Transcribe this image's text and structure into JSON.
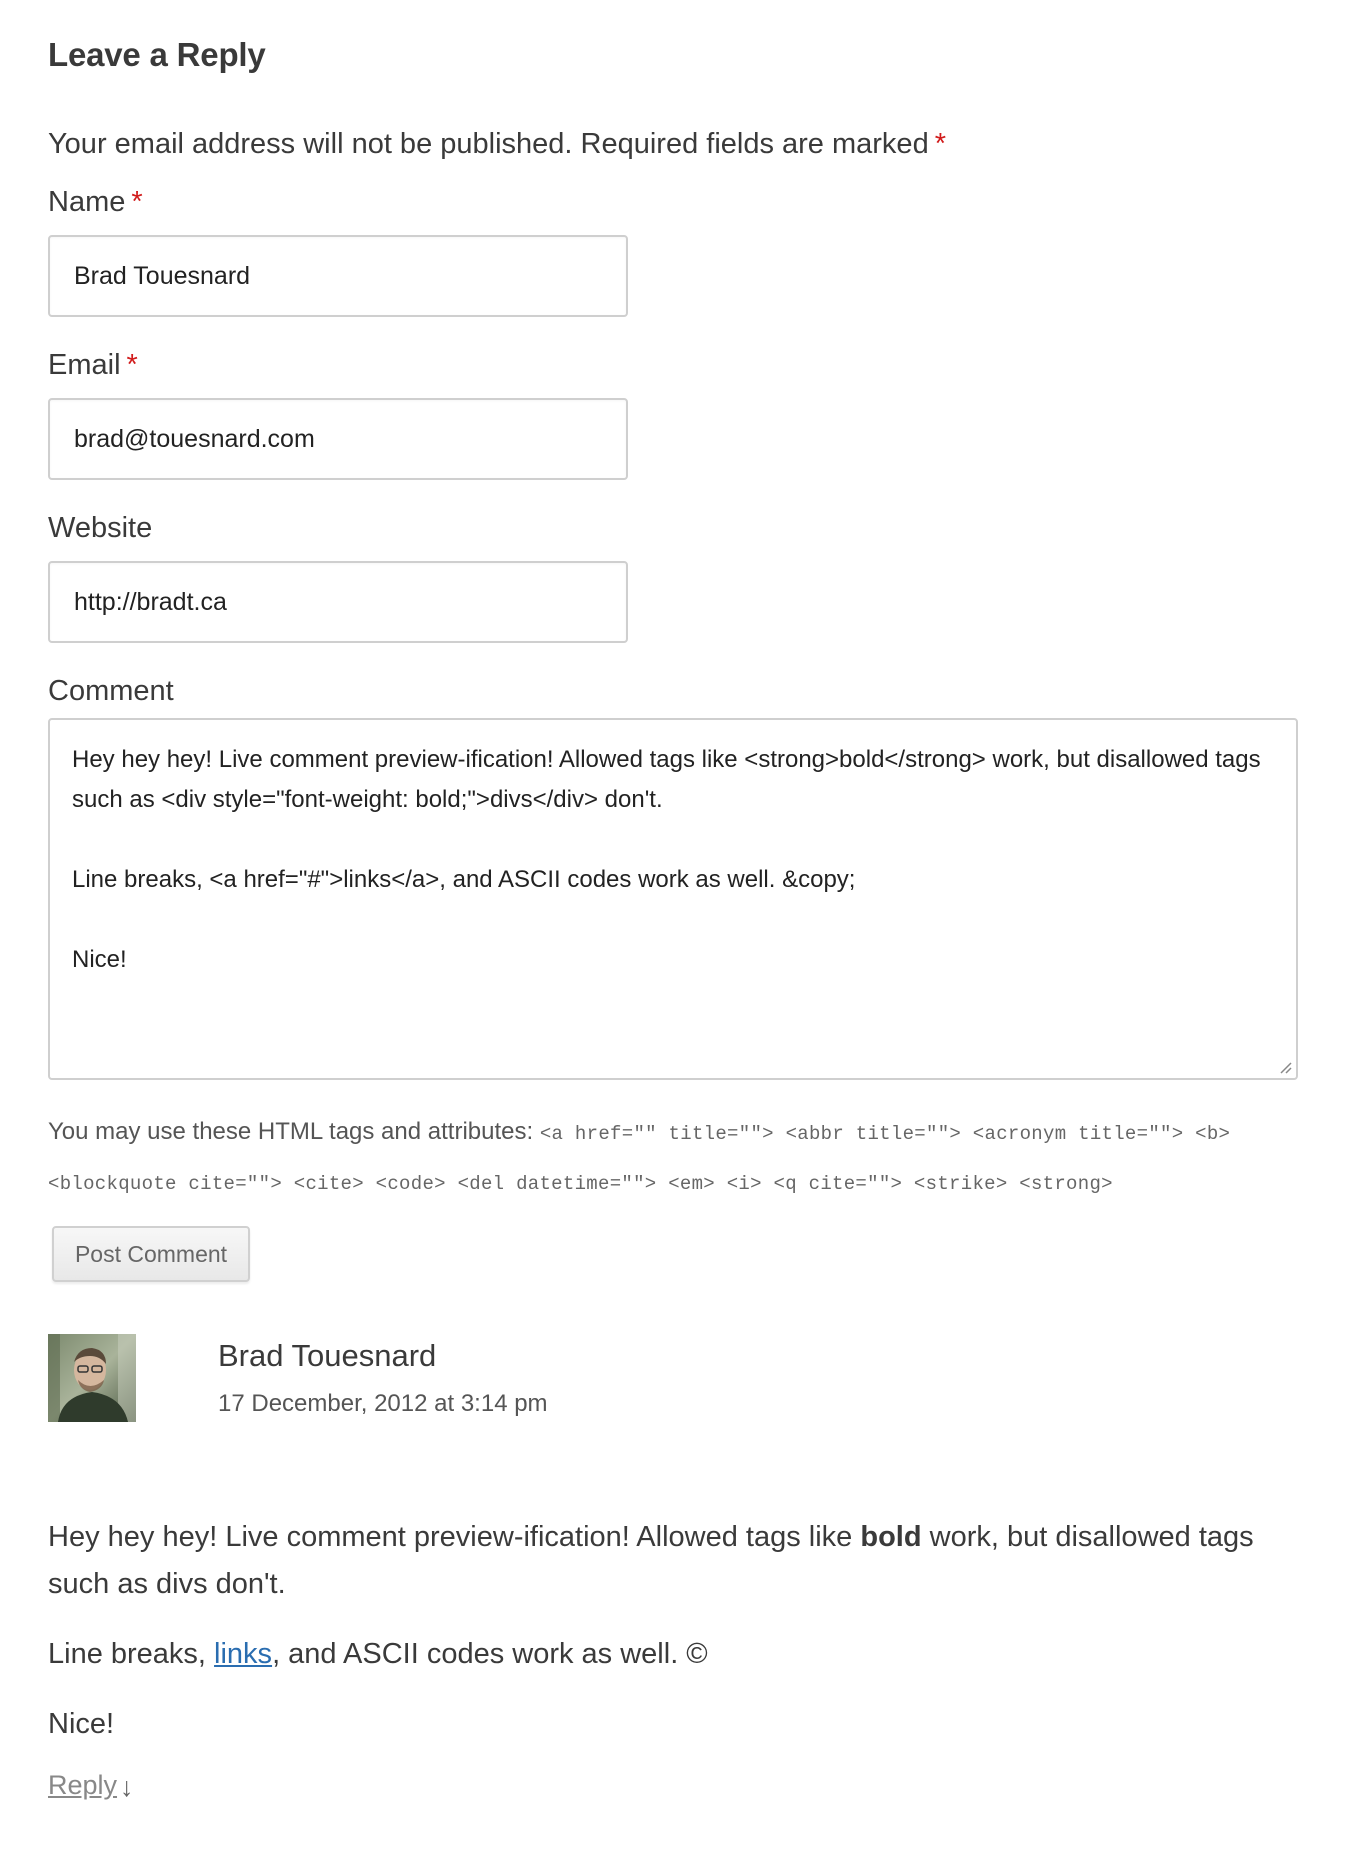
{
  "reply_form": {
    "title": "Leave a Reply",
    "notes": "Your email address will not be published. Required fields are marked",
    "required_mark": "*",
    "name_label": "Name",
    "name_value": "Brad Touesnard",
    "email_label": "Email",
    "email_value": "brad@touesnard.com",
    "website_label": "Website",
    "website_value": "http://bradt.ca",
    "comment_label": "Comment",
    "comment_value": "Hey hey hey! Live comment preview-ification! Allowed tags like <strong>bold</strong> work, but disallowed tags such as <div style=\"font-weight: bold;\">divs</div> don't.\n\nLine breaks, <a href=\"#\">links</a>, and ASCII codes work as well. &copy;\n\nNice!",
    "allowed_tags_intro": "You may use these HTML tags and attributes:",
    "allowed_tags": "<a href=\"\" title=\"\"> <abbr title=\"\"> <acronym title=\"\"> <b> <blockquote cite=\"\"> <cite> <code> <del datetime=\"\"> <em> <i> <q cite=\"\"> <strike> <strong>",
    "submit_label": "Post Comment"
  },
  "comment": {
    "author": "Brad Touesnard",
    "date": "17 December, 2012 at 3:14 pm",
    "avatar_icon": "user-avatar-photo",
    "paragraph1_before": "Hey hey hey! Live comment preview-ification! Allowed tags like ",
    "paragraph1_bold": "bold",
    "paragraph1_after": " work, but disallowed tags such as divs don't.",
    "paragraph2_before": "Line breaks, ",
    "paragraph2_link": "links",
    "paragraph2_after": ", and ASCII codes work as well. ©",
    "paragraph3": "Nice!",
    "reply_label": "Reply",
    "reply_arrow": "↓"
  },
  "colors": {
    "required": "#d11b1b",
    "link": "#2a6db0",
    "text": "#3a3a3a"
  }
}
